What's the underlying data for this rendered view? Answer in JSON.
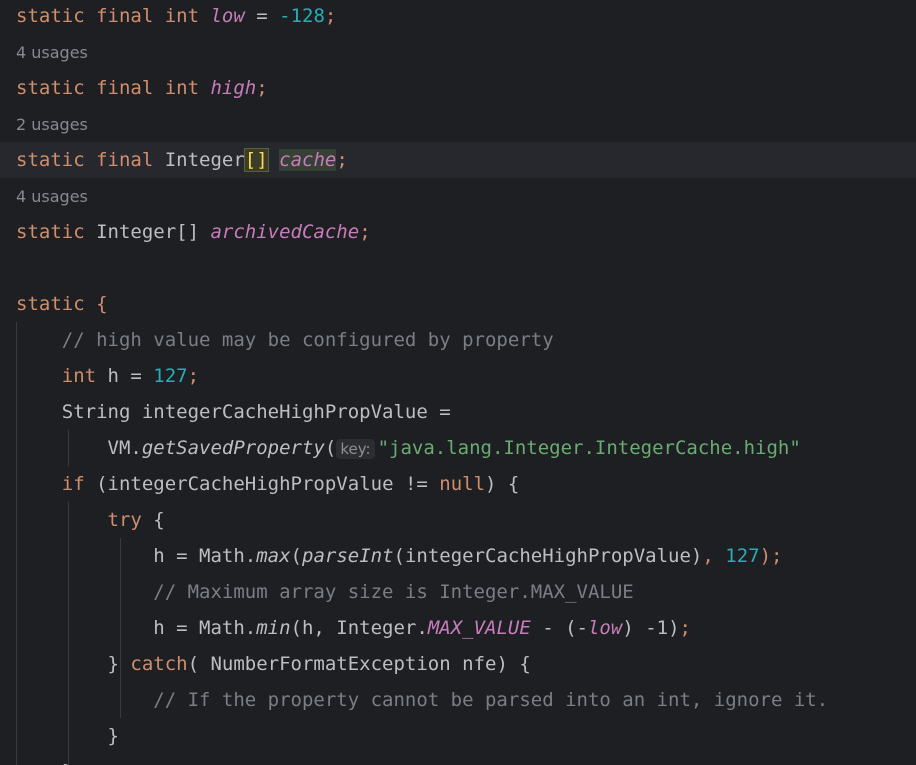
{
  "editor": {
    "lines": [
      {
        "kind": "code",
        "current": false,
        "tokens": [
          {
            "t": "static final int ",
            "c": "kw"
          },
          {
            "t": "low",
            "c": "sf"
          },
          {
            "t": " = ",
            "c": ""
          },
          {
            "t": "-128",
            "c": "num"
          },
          {
            "t": ";",
            "c": "kw"
          }
        ]
      },
      {
        "kind": "hint",
        "text": "4 usages"
      },
      {
        "kind": "code",
        "current": false,
        "tokens": [
          {
            "t": "static final int ",
            "c": "kw"
          },
          {
            "t": "high",
            "c": "sf"
          },
          {
            "t": ";",
            "c": "kw"
          }
        ]
      },
      {
        "kind": "hint",
        "text": "2 usages"
      },
      {
        "kind": "code",
        "current": true,
        "tokens": [
          {
            "t": "static final ",
            "c": "kw"
          },
          {
            "t": "Integer",
            "c": ""
          },
          {
            "t": "[]",
            "c": "brace-match"
          },
          {
            "t": " ",
            "c": ""
          },
          {
            "t": "cache",
            "c": "sf usage-hl"
          },
          {
            "t": ";",
            "c": "kw"
          }
        ]
      },
      {
        "kind": "hint",
        "text": "4 usages"
      },
      {
        "kind": "code",
        "current": false,
        "tokens": [
          {
            "t": "static ",
            "c": "kw"
          },
          {
            "t": "Integer[] ",
            "c": ""
          },
          {
            "t": "archivedCache",
            "c": "sf"
          },
          {
            "t": ";",
            "c": "kw"
          }
        ]
      },
      {
        "kind": "code",
        "current": false,
        "tokens": []
      },
      {
        "kind": "code",
        "current": false,
        "tokens": [
          {
            "t": "static ",
            "c": "kw"
          },
          {
            "t": "{",
            "c": "kw"
          }
        ]
      },
      {
        "kind": "code",
        "current": false,
        "tokens": [
          {
            "t": "    // high value may be configured by property",
            "c": "cm"
          }
        ]
      },
      {
        "kind": "code",
        "current": false,
        "tokens": [
          {
            "t": "    ",
            "c": ""
          },
          {
            "t": "int ",
            "c": "kw"
          },
          {
            "t": "h = ",
            "c": ""
          },
          {
            "t": "127",
            "c": "num"
          },
          {
            "t": ";",
            "c": "kw"
          }
        ]
      },
      {
        "kind": "code",
        "current": false,
        "tokens": [
          {
            "t": "    String integerCacheHighPropValue =",
            "c": ""
          }
        ]
      },
      {
        "kind": "code",
        "current": false,
        "tokens": [
          {
            "t": "        VM.",
            "c": ""
          },
          {
            "t": "getSavedProperty",
            "c": "it"
          },
          {
            "t": "(",
            "c": ""
          },
          {
            "t": "key:",
            "c": "param-hint"
          },
          {
            "t": "\"java.lang.Integer.IntegerCache.high\"",
            "c": "str"
          }
        ]
      },
      {
        "kind": "code",
        "current": false,
        "tokens": [
          {
            "t": "    ",
            "c": ""
          },
          {
            "t": "if ",
            "c": "kw"
          },
          {
            "t": "(integerCacheHighPropValue != ",
            "c": ""
          },
          {
            "t": "null",
            "c": "kw"
          },
          {
            "t": ") {",
            "c": ""
          }
        ]
      },
      {
        "kind": "code",
        "current": false,
        "tokens": [
          {
            "t": "        ",
            "c": ""
          },
          {
            "t": "try ",
            "c": "kw"
          },
          {
            "t": "{",
            "c": ""
          }
        ]
      },
      {
        "kind": "code",
        "current": false,
        "tokens": [
          {
            "t": "            h = Math.",
            "c": ""
          },
          {
            "t": "max",
            "c": "it"
          },
          {
            "t": "(",
            "c": ""
          },
          {
            "t": "parseInt",
            "c": "it"
          },
          {
            "t": "(integerCacheHighPropValue)",
            "c": ""
          },
          {
            "t": ", ",
            "c": "kw"
          },
          {
            "t": "127",
            "c": "num"
          },
          {
            "t": ");",
            "c": "kw"
          }
        ]
      },
      {
        "kind": "code",
        "current": false,
        "tokens": [
          {
            "t": "            // Maximum array size is Integer.MAX_VALUE",
            "c": "cm"
          }
        ]
      },
      {
        "kind": "code",
        "current": false,
        "tokens": [
          {
            "t": "            h = Math.",
            "c": ""
          },
          {
            "t": "min",
            "c": "it"
          },
          {
            "t": "(h, Integer.",
            "c": ""
          },
          {
            "t": "MAX_VALUE",
            "c": "sf"
          },
          {
            "t": " - (-",
            "c": ""
          },
          {
            "t": "low",
            "c": "sf"
          },
          {
            "t": ") -1)",
            "c": ""
          },
          {
            "t": ";",
            "c": "kw"
          }
        ]
      },
      {
        "kind": "code",
        "current": false,
        "tokens": [
          {
            "t": "        } ",
            "c": ""
          },
          {
            "t": "catch",
            "c": "kw"
          },
          {
            "t": "( NumberFormatException nfe) {",
            "c": ""
          }
        ]
      },
      {
        "kind": "code",
        "current": false,
        "tokens": [
          {
            "t": "            // If the property cannot be parsed into an int, ignore it.",
            "c": "cm"
          }
        ]
      },
      {
        "kind": "code",
        "current": false,
        "tokens": [
          {
            "t": "        }",
            "c": ""
          }
        ]
      },
      {
        "kind": "code",
        "current": false,
        "tokens": [
          {
            "t": "    }",
            "c": ""
          }
        ]
      }
    ]
  }
}
